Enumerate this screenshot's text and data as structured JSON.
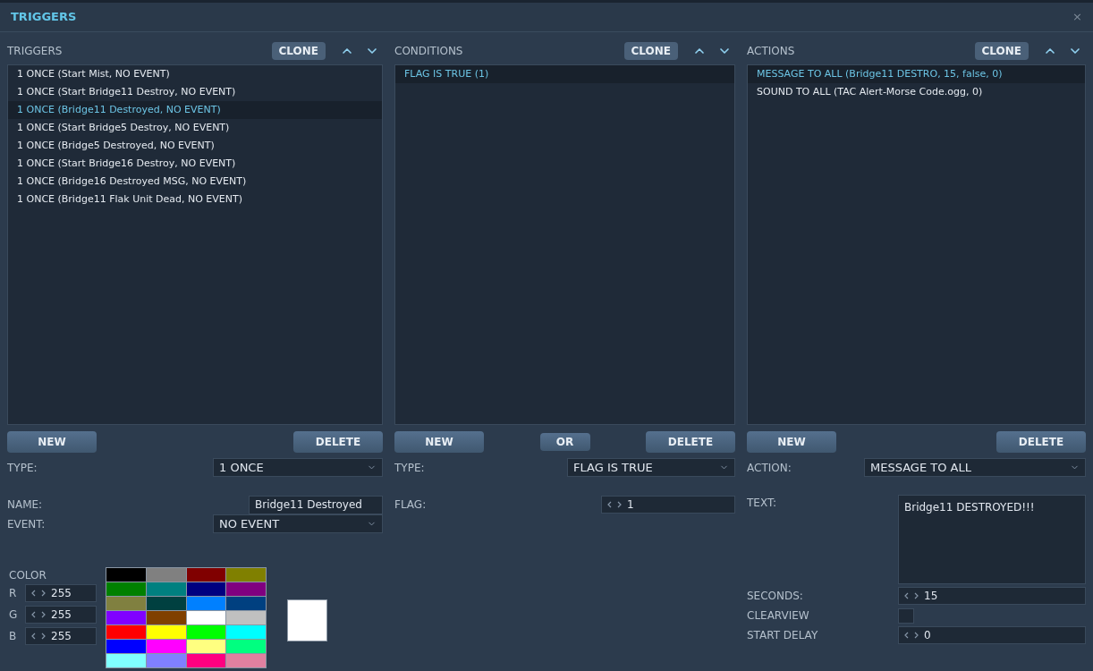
{
  "window": {
    "title": "TRIGGERS",
    "close": "×"
  },
  "panels": [
    {
      "title": "TRIGGERS",
      "clone": "CLONE",
      "items": [
        {
          "text": "1 ONCE (Start Mist, NO EVENT)",
          "selected": false
        },
        {
          "text": "1 ONCE (Start Bridge11 Destroy, NO EVENT)",
          "selected": false
        },
        {
          "text": "1 ONCE (Bridge11 Destroyed, NO EVENT)",
          "selected": true
        },
        {
          "text": "1 ONCE (Start Bridge5 Destroy, NO EVENT)",
          "selected": false
        },
        {
          "text": "1 ONCE (Bridge5 Destroyed, NO EVENT)",
          "selected": false
        },
        {
          "text": "1 ONCE (Start Bridge16 Destroy, NO EVENT)",
          "selected": false
        },
        {
          "text": "1 ONCE (Bridge16 Destroyed MSG, NO EVENT)",
          "selected": false
        },
        {
          "text": "1 ONCE (Bridge11 Flak Unit Dead, NO EVENT)",
          "selected": false
        }
      ],
      "buttons": [
        {
          "label": "NEW",
          "kind": "main"
        },
        {
          "label": "DELETE",
          "kind": "main"
        }
      ],
      "fields": [
        {
          "kind": "select",
          "label": "TYPE:",
          "value": "1 ONCE"
        },
        {
          "kind": "text",
          "label": "NAME:",
          "value": "Bridge11 Destroyed"
        },
        {
          "kind": "select",
          "label": "EVENT:",
          "value": "NO EVENT"
        }
      ],
      "color": {
        "label": "COLOR",
        "channels": [
          {
            "label": "R",
            "value": "255"
          },
          {
            "label": "G",
            "value": "255"
          },
          {
            "label": "B",
            "value": "255"
          }
        ],
        "swatches": [
          {
            "color": "#000000"
          },
          {
            "color": "#808080"
          },
          {
            "color": "#800000"
          },
          {
            "color": "#808000"
          },
          {
            "color": "#008000"
          },
          {
            "color": "#008080"
          },
          {
            "color": "#000080"
          },
          {
            "color": "#800080"
          },
          {
            "color": "#808040"
          },
          {
            "color": "#004040"
          },
          {
            "color": "#0080ff"
          },
          {
            "color": "#004080"
          },
          {
            "color": "#8000ff"
          },
          {
            "color": "#804000"
          },
          {
            "color": "#ffffff"
          },
          {
            "color": "#c0c0c0"
          },
          {
            "color": "#ff0000"
          },
          {
            "color": "#ffff00"
          },
          {
            "color": "#00ff00"
          },
          {
            "color": "#00ffff"
          },
          {
            "color": "#0000ff"
          },
          {
            "color": "#ff00ff"
          },
          {
            "color": "#ffff80"
          },
          {
            "color": "#00ff80"
          },
          {
            "color": "#80ffff"
          },
          {
            "color": "#8080ff"
          },
          {
            "color": "#ff0080"
          },
          {
            "color": "#e080a0"
          }
        ]
      }
    },
    {
      "title": "CONDITIONS",
      "clone": "CLONE",
      "items": [
        {
          "text": "FLAG IS TRUE (1)",
          "selected": true
        }
      ],
      "buttons": [
        {
          "label": "NEW",
          "kind": "main"
        },
        {
          "label": "OR",
          "kind": "small"
        },
        {
          "label": "DELETE",
          "kind": "main"
        }
      ],
      "fields": [
        {
          "kind": "select",
          "label": "TYPE:",
          "value": "FLAG IS TRUE"
        },
        {
          "kind": "spinner",
          "label": "FLAG:",
          "value": "1"
        }
      ]
    },
    {
      "title": "ACTIONS",
      "clone": "CLONE",
      "items": [
        {
          "text": "MESSAGE TO ALL (Bridge11 DESTRO, 15, false, 0)",
          "selected": true
        },
        {
          "text": "SOUND TO ALL (TAC Alert-Morse Code.ogg, 0)",
          "selected": false
        }
      ],
      "buttons": [
        {
          "label": "NEW",
          "kind": "main"
        },
        {
          "label": "DELETE",
          "kind": "main"
        }
      ],
      "fields": [
        {
          "kind": "select",
          "label": "ACTION:",
          "value": "MESSAGE TO ALL"
        },
        {
          "kind": "textarea",
          "label": "TEXT:",
          "value": "Bridge11 DESTROYED!!!"
        },
        {
          "kind": "spinner",
          "label": "SECONDS:",
          "value": "15"
        },
        {
          "kind": "checkbox",
          "label": "CLEARVIEW",
          "checked": false
        },
        {
          "kind": "spinner",
          "label": "START DELAY",
          "value": "0"
        }
      ]
    }
  ]
}
